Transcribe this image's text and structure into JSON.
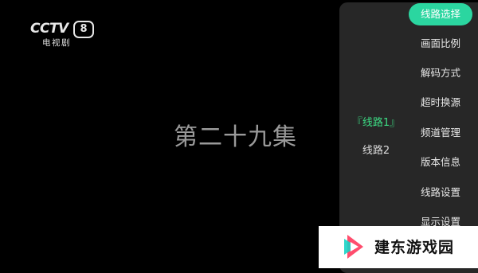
{
  "channel": {
    "logo_text": "CCTV",
    "logo_number": "8",
    "logo_subtitle": "电视剧"
  },
  "episode_title": "第二十九集",
  "routes": {
    "items": [
      {
        "label": "『线路1』",
        "active": true
      },
      {
        "label": "线路2",
        "active": false
      }
    ]
  },
  "menu": {
    "items": [
      {
        "label": "线路选择",
        "active": true
      },
      {
        "label": "画面比例"
      },
      {
        "label": "解码方式"
      },
      {
        "label": "超时换源"
      },
      {
        "label": "频道管理"
      },
      {
        "label": "版本信息"
      },
      {
        "label": "线路设置"
      },
      {
        "label": "显示设置"
      }
    ]
  },
  "watermark": {
    "text": "建东游戏园"
  },
  "colors": {
    "accent": "#2bd6a0",
    "active_route": "#3ddc84"
  }
}
